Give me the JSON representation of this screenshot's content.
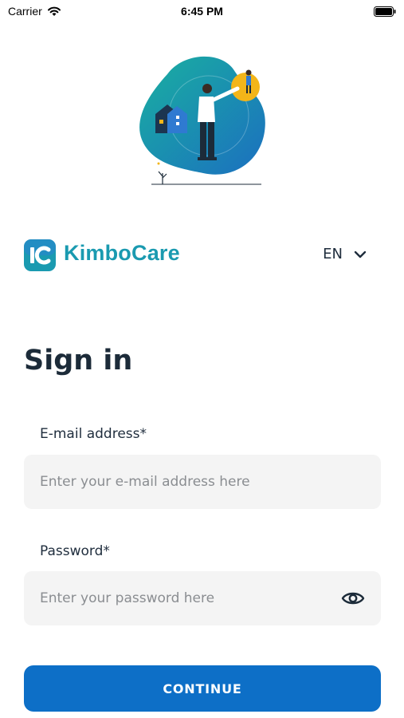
{
  "status_bar": {
    "carrier": "Carrier",
    "time": "6:45 PM"
  },
  "brand": {
    "logo_text": "KC",
    "name": "KimboCare",
    "color": "#1a9ab0"
  },
  "language": {
    "selected": "EN"
  },
  "signin": {
    "title": "Sign in",
    "email": {
      "label": "E-mail address*",
      "placeholder": "Enter your e-mail address here",
      "value": ""
    },
    "password": {
      "label": "Password*",
      "placeholder": "Enter your password here",
      "value": ""
    },
    "continue_label": "CONTINUE"
  },
  "colors": {
    "primary": "#0d6fc7",
    "field_bg": "#f4f4f4",
    "text": "#1f2d3d"
  },
  "icons": {
    "wifi": "wifi-icon",
    "battery": "battery-icon",
    "chevron": "chevron-down-icon",
    "eye": "eye-icon"
  }
}
